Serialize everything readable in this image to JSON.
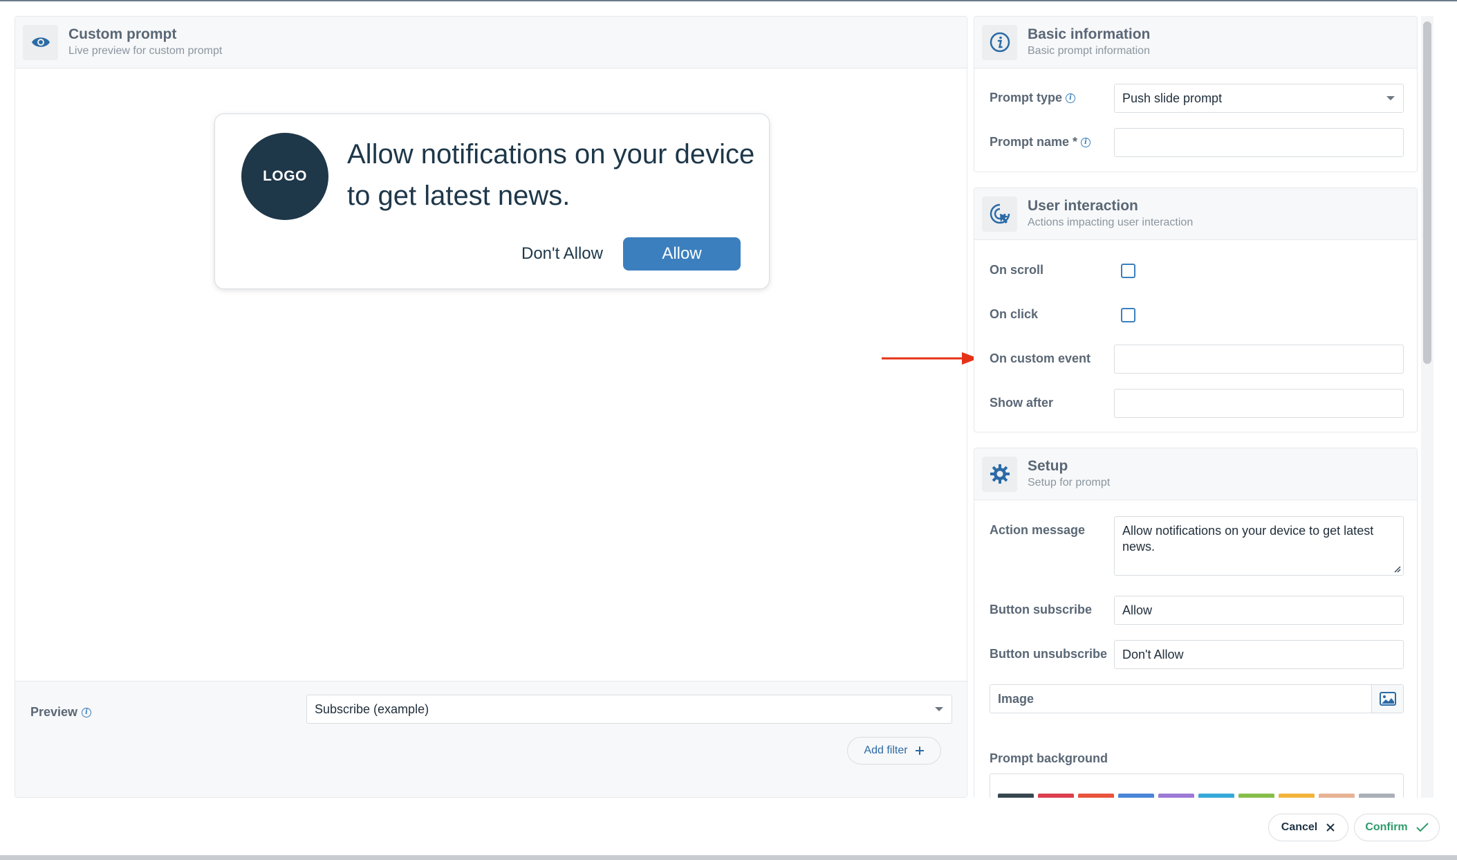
{
  "left_panel": {
    "title": "Custom prompt",
    "subtitle": "Live preview for custom prompt",
    "icon": "eye-icon",
    "prompt_card": {
      "logo_text": "LOGO",
      "message": "Allow notifications on your device to get latest news.",
      "dont_allow_label": "Don't Allow",
      "allow_label": "Allow"
    },
    "footer": {
      "preview_label": "Preview",
      "preview_select_value": "Subscribe (example)",
      "add_filter_label": "Add filter"
    }
  },
  "basic_info": {
    "title": "Basic information",
    "subtitle": "Basic prompt information",
    "icon": "info-icon",
    "prompt_type_label": "Prompt type",
    "prompt_type_value": "Push slide prompt",
    "prompt_name_label": "Prompt name *",
    "prompt_name_value": ""
  },
  "user_interaction": {
    "title": "User interaction",
    "subtitle": "Actions impacting user interaction",
    "icon": "cursor-click-icon",
    "on_scroll_label": "On scroll",
    "on_click_label": "On click",
    "on_custom_event_label": "On custom event",
    "on_custom_event_value": "",
    "show_after_label": "Show after",
    "show_after_value": ""
  },
  "setup": {
    "title": "Setup",
    "subtitle": "Setup for prompt",
    "icon": "gear-icon",
    "action_message_label": "Action message",
    "action_message_value": "Allow notifications on your device to get latest news.",
    "button_subscribe_label": "Button subscribe",
    "button_subscribe_value": "Allow",
    "button_unsubscribe_label": "Button unsubscribe",
    "button_unsubscribe_value": "Don't Allow",
    "image_label": "Image",
    "prompt_background_label": "Prompt background",
    "background_colors": [
      "#37474f",
      "#dc3f4d",
      "#e8543d",
      "#4a86d8",
      "#9c7ad6",
      "#35a9d9",
      "#86be4b",
      "#f3b43c",
      "#e7b394",
      "#a9b0b8"
    ]
  },
  "actions": {
    "cancel_label": "Cancel",
    "confirm_label": "Confirm"
  },
  "colors": {
    "accent": "#3b7fbe",
    "logo_bg": "#1e3749",
    "confirm": "#2e9a6a",
    "annotation_arrow": "#e53216"
  }
}
